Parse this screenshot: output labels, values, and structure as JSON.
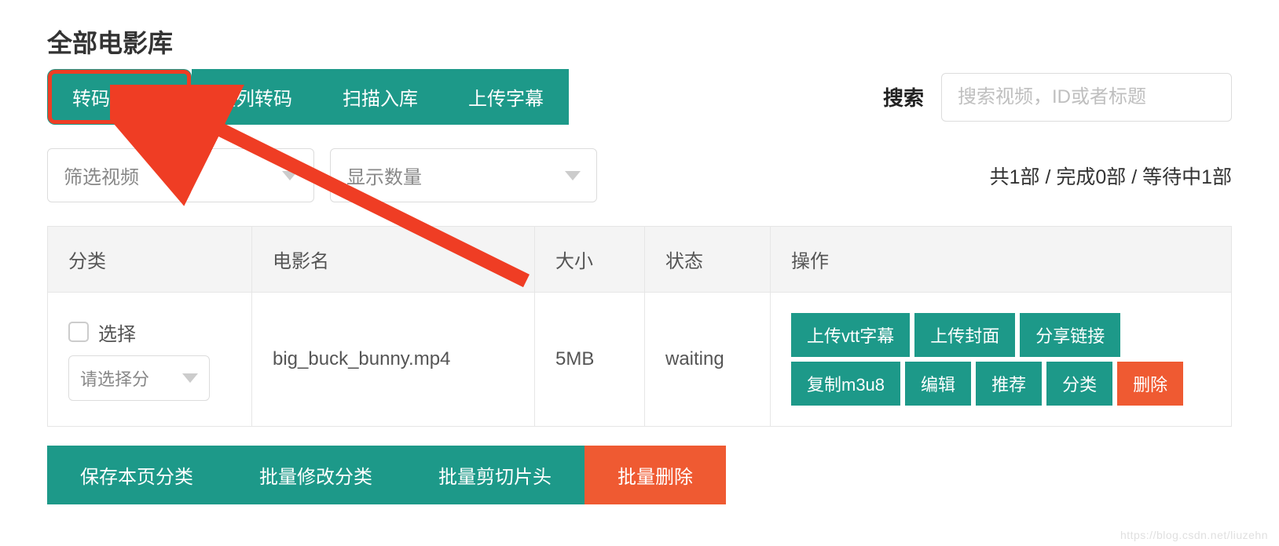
{
  "page_title": "全部电影库",
  "toolbar": {
    "buttons": [
      "转码并切片",
      "队列转码",
      "扫描入库",
      "上传字幕"
    ]
  },
  "search": {
    "label": "搜索",
    "placeholder": "搜索视频，ID或者标题"
  },
  "filters": {
    "video_filter_label": "筛选视频",
    "display_count_label": "显示数量"
  },
  "status_summary": "共1部 / 完成0部 / 等待中1部",
  "table": {
    "headers": {
      "category": "分类",
      "name": "电影名",
      "size": "大小",
      "status": "状态",
      "actions": "操作"
    },
    "row": {
      "select_label": "选择",
      "category_placeholder": "请选择分",
      "name": "big_buck_bunny.mp4",
      "size": "5MB",
      "status": "waiting",
      "ops": {
        "upload_vtt": "上传vtt字幕",
        "upload_cover": "上传封面",
        "share_link": "分享链接",
        "copy_m3u8": "复制m3u8",
        "edit": "编辑",
        "recommend": "推荐",
        "category": "分类",
        "delete": "删除"
      }
    }
  },
  "bottom_actions": {
    "save_page_category": "保存本页分类",
    "batch_modify_category": "批量修改分类",
    "batch_cut_header": "批量剪切片头",
    "batch_delete": "批量删除"
  },
  "watermark": "https://blog.csdn.net/liuzehn"
}
